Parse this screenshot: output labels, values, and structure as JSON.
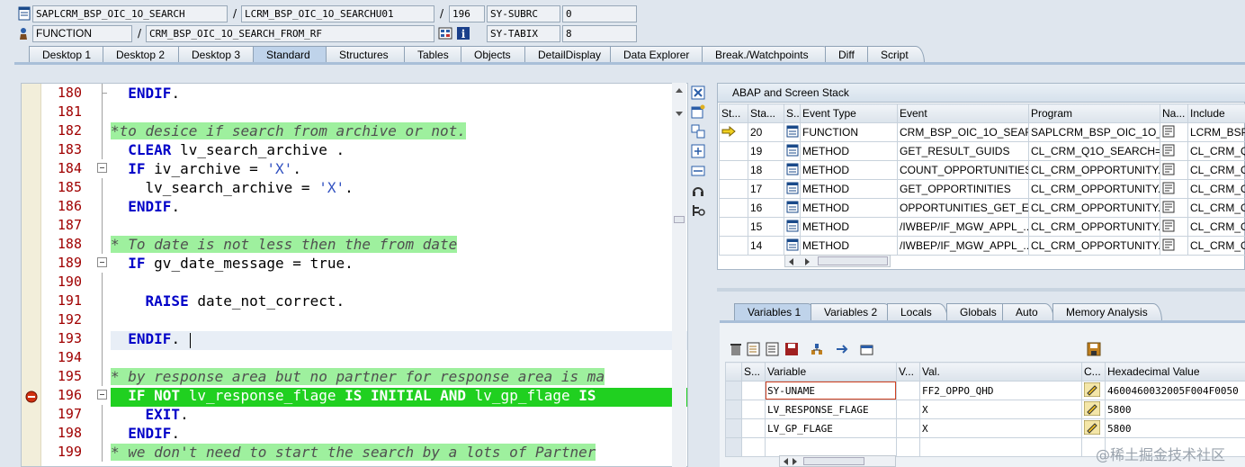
{
  "header": {
    "program": "SAPLCRM_BSP_OIC_1O_SEARCH",
    "include": "LCRM_BSP_OIC_1O_SEARCHU01",
    "line": "196",
    "subrc_label": "SY-SUBRC",
    "subrc_value": "0",
    "type": "FUNCTION",
    "event": "CRM_BSP_OIC_1O_SEARCH_FROM_RF",
    "tabix_label": "SY-TABIX",
    "tabix_value": "8",
    "slash": "/"
  },
  "tabs": [
    "Desktop 1",
    "Desktop 2",
    "Desktop 3",
    "Standard",
    "Structures",
    "Tables",
    "Objects",
    "DetailDisplay",
    "Data Explorer",
    "Break./Watchpoints",
    "Diff",
    "Script"
  ],
  "active_tab": "Standard",
  "editor": {
    "lines": [
      {
        "n": "180",
        "code": "  ENDIF."
      },
      {
        "n": "181",
        "code": ""
      },
      {
        "n": "182",
        "code": "*to desice if search from archive or not."
      },
      {
        "n": "183",
        "code": "  CLEAR lv_search_archive ."
      },
      {
        "n": "184",
        "code": "  IF iv_archive = 'X'."
      },
      {
        "n": "185",
        "code": "    lv_search_archive = 'X'."
      },
      {
        "n": "186",
        "code": "  ENDIF."
      },
      {
        "n": "187",
        "code": ""
      },
      {
        "n": "188",
        "code": "* To date is not less then the from date"
      },
      {
        "n": "189",
        "code": "  IF gv_date_message = true."
      },
      {
        "n": "190",
        "code": ""
      },
      {
        "n": "191",
        "code": "    RAISE date_not_correct."
      },
      {
        "n": "192",
        "code": ""
      },
      {
        "n": "193",
        "code": "  ENDIF."
      },
      {
        "n": "194",
        "code": ""
      },
      {
        "n": "195",
        "code": "* by response area but no partner for response area is ma"
      },
      {
        "n": "196",
        "code": "  IF NOT lv_response_flage IS INITIAL AND lv_gp_flage IS"
      },
      {
        "n": "197",
        "code": "    EXIT."
      },
      {
        "n": "198",
        "code": "  ENDIF."
      },
      {
        "n": "199",
        "code": "* we don't need to start the search by a lots of Partner"
      }
    ]
  },
  "stack": {
    "title": "ABAP and Screen Stack",
    "columns": [
      "St...",
      "Sta...",
      "S...",
      "Event Type",
      "Event",
      "Program",
      "Na...",
      "Include"
    ],
    "rows": [
      {
        "level": "20",
        "type": "FUNCTION",
        "event": "CRM_BSP_OIC_1O_SEAR...",
        "program": "SAPLCRM_BSP_OIC_1O_...",
        "include": "LCRM_BSP_",
        "current": true
      },
      {
        "level": "19",
        "type": "METHOD",
        "event": "GET_RESULT_GUIDS",
        "program": "CL_CRM_Q1O_SEARCH=...",
        "include": "CL_CRM_Q",
        "current": false
      },
      {
        "level": "18",
        "type": "METHOD",
        "event": "COUNT_OPPORTUNITIES",
        "program": "CL_CRM_OPPORTUNITY...",
        "include": "CL_CRM_O",
        "current": false
      },
      {
        "level": "17",
        "type": "METHOD",
        "event": "GET_OPPORTINITIES",
        "program": "CL_CRM_OPPORTUNITY...",
        "include": "CL_CRM_O",
        "current": false
      },
      {
        "level": "16",
        "type": "METHOD",
        "event": "OPPORTUNITIES_GET_E...",
        "program": "CL_CRM_OPPORTUNITY...",
        "include": "CL_CRM_O",
        "current": false
      },
      {
        "level": "15",
        "type": "METHOD",
        "event": "/IWBEP/IF_MGW_APPL_...",
        "program": "CL_CRM_OPPORTUNITY...",
        "include": "CL_CRM_O",
        "current": false
      },
      {
        "level": "14",
        "type": "METHOD",
        "event": "/IWBEP/IF_MGW_APPL_...",
        "program": "CL_CRM_OPPORTUNITY...",
        "include": "CL_CRM_O",
        "current": false
      }
    ]
  },
  "var_tabs": [
    "Variables 1",
    "Variables 2",
    "Locals",
    "Globals",
    "Auto",
    "Memory Analysis"
  ],
  "active_var_tab": "Variables 1",
  "variables": {
    "columns": [
      "S...",
      "Variable",
      "V...",
      "Val.",
      "C...",
      "Hexadecimal Value"
    ],
    "rows": [
      {
        "name": "SY-UNAME",
        "value": "FF2_OPPO_QHD",
        "hex": "4600460032005F004F0050"
      },
      {
        "name": "LV_RESPONSE_FLAGE",
        "value": "X",
        "hex": "5800"
      },
      {
        "name": "LV_GP_FLAGE",
        "value": "X",
        "hex": "5800"
      }
    ]
  },
  "watermark": "@稀土掘金技术社区",
  "colors": {
    "current_line": "#20d020",
    "comment_bg": "#9ef09e",
    "keyword": "#0000c8",
    "line_number": "#a00000"
  }
}
